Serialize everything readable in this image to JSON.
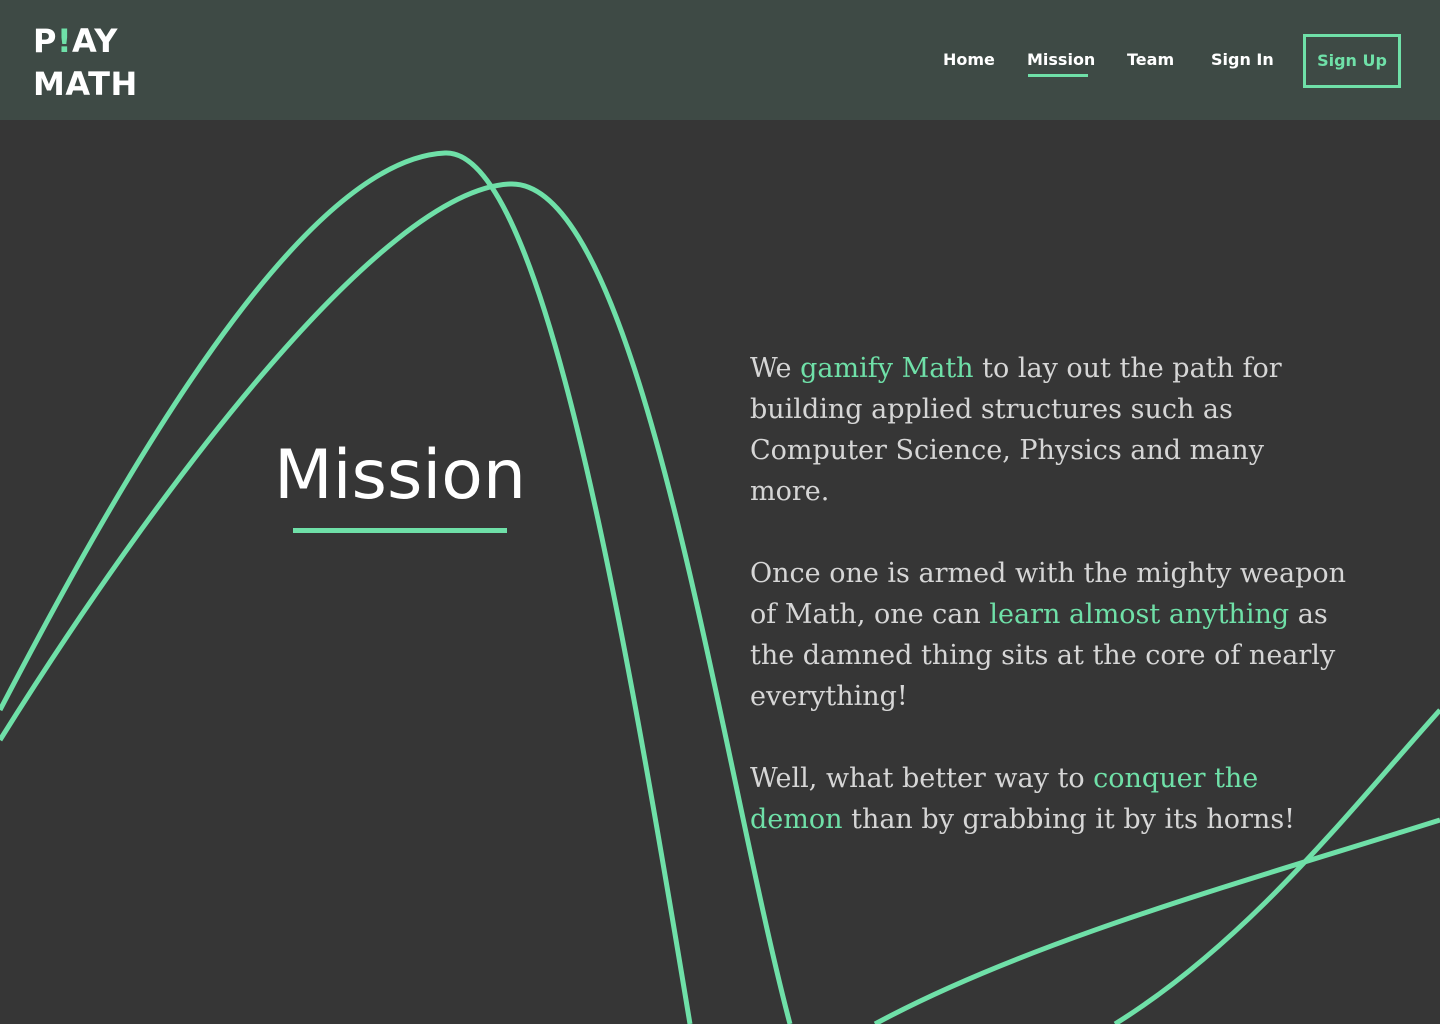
{
  "header": {
    "logo": {
      "line1_start": "P",
      "line1_accent": "!",
      "line1_end": "AY",
      "line2": "MATH"
    },
    "nav": [
      {
        "label": "Home"
      },
      {
        "label": "Mission",
        "active": true
      },
      {
        "label": "Team"
      },
      {
        "label": "Sign In"
      }
    ],
    "signup_label": "Sign Up"
  },
  "main": {
    "heading": "Mission",
    "paragraphs": [
      [
        {
          "text": "We ",
          "highlight": false
        },
        {
          "text": "gamify Math",
          "highlight": true
        },
        {
          "text": " to lay out the path for building applied structures such as Computer Science, Physics and many more.",
          "highlight": false
        }
      ],
      [
        {
          "text": "Once one is armed with the mighty weapon of Math, one can ",
          "highlight": false
        },
        {
          "text": "learn almost anything",
          "highlight": true
        },
        {
          "text": " as the damned thing sits at the core of nearly everything!",
          "highlight": false
        }
      ],
      [
        {
          "text": "Well, what better way to ",
          "highlight": false
        },
        {
          "text": "conquer the demon",
          "highlight": true
        },
        {
          "text": " than by grabbing it by its horns!",
          "highlight": false
        }
      ]
    ]
  },
  "colors": {
    "accent": "#6fe0a8",
    "header_bg": "#3e4a45",
    "page_bg": "#363636",
    "text": "#d6d6d6"
  }
}
